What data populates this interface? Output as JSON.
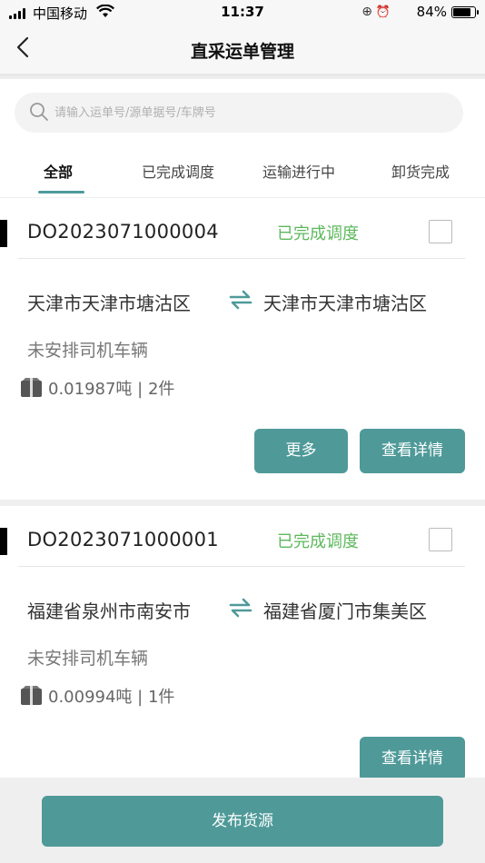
{
  "status_bar": {
    "carrier": "中国移动",
    "time": "11:37",
    "battery": "84%",
    "battery_level": 0.84
  },
  "nav": {
    "title": "直采运单管理",
    "back_icon": "chevron-left-icon"
  },
  "search": {
    "placeholder": "请输入运单号/源单据号/车牌号",
    "icon": "search-icon"
  },
  "tabs": [
    {
      "label": "全部",
      "active": true
    },
    {
      "label": "已完成调度",
      "active": false
    },
    {
      "label": "运输进行中",
      "active": false
    },
    {
      "label": "卸货完成",
      "active": false
    }
  ],
  "orders": [
    {
      "order_no": "DO2023071000004",
      "status": "已完成调度",
      "from": "天津市天津市塘沽区",
      "to": "天津市天津市塘沽区",
      "driver": "未安排司机车辆",
      "cargo": "0.01987吨 | 2件",
      "more_label": "更多",
      "detail_label": "查看详情"
    },
    {
      "order_no": "DO2023071000001",
      "status": "已完成调度",
      "from": "福建省泉州市南安市",
      "to": "福建省厦门市集美区",
      "driver": "未安排司机车辆",
      "cargo": "0.00994吨 | 1件",
      "detail_label": "查看详情"
    }
  ],
  "bottom": {
    "publish_label": "发布货源"
  },
  "colors": {
    "accent": "#4f9a99",
    "status_green": "#5cb85c"
  }
}
